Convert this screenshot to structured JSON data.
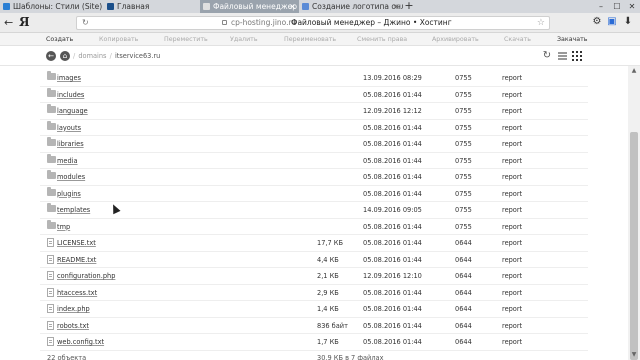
{
  "browser": {
    "tabs": [
      {
        "title": "Шаблоны: Стили (Site) - Ко",
        "favicon_color": "#2a7fd4",
        "active": false
      },
      {
        "title": "Главная",
        "favicon_color": "#1b4f8a",
        "active": false
      },
      {
        "title": "Файловый менеджер",
        "favicon_color": "#e0e0e0",
        "active": true
      },
      {
        "title": "Создание логотипа онлайн",
        "favicon_color": "#5b8bd6",
        "active": false
      }
    ],
    "new_tab": "+",
    "close_glyph": "×",
    "window_controls": [
      "–",
      "☐",
      "✕"
    ],
    "address": {
      "host": "cp-hosting.jino.ru",
      "page_title": "Файловый менеджер – Джино • Хостинг"
    },
    "logo": "Я"
  },
  "fm_toolbar": {
    "actions": [
      {
        "label": "Создать",
        "enabled": true
      },
      {
        "label": "Копировать",
        "enabled": false
      },
      {
        "label": "Переместить",
        "enabled": false
      },
      {
        "label": "Удалить",
        "enabled": false
      },
      {
        "label": "Переименовать",
        "enabled": false
      },
      {
        "label": "Сменить права",
        "enabled": false
      },
      {
        "label": "Архивировать",
        "enabled": false
      },
      {
        "label": "Скачать",
        "enabled": false
      },
      {
        "label": "Закачать",
        "enabled": true
      }
    ]
  },
  "path": {
    "separator": "/",
    "root": "domains",
    "current": "itservice63.ru"
  },
  "files": [
    {
      "name": "images",
      "type": "folder",
      "size": "",
      "date": "13.09.2016 08:29",
      "perm": "0755",
      "owner": "report"
    },
    {
      "name": "includes",
      "type": "folder",
      "size": "",
      "date": "05.08.2016 01:44",
      "perm": "0755",
      "owner": "report"
    },
    {
      "name": "language",
      "type": "folder",
      "size": "",
      "date": "12.09.2016 12:12",
      "perm": "0755",
      "owner": "report"
    },
    {
      "name": "layouts",
      "type": "folder",
      "size": "",
      "date": "05.08.2016 01:44",
      "perm": "0755",
      "owner": "report"
    },
    {
      "name": "libraries",
      "type": "folder",
      "size": "",
      "date": "05.08.2016 01:44",
      "perm": "0755",
      "owner": "report"
    },
    {
      "name": "media",
      "type": "folder",
      "size": "",
      "date": "05.08.2016 01:44",
      "perm": "0755",
      "owner": "report"
    },
    {
      "name": "modules",
      "type": "folder",
      "size": "",
      "date": "05.08.2016 01:44",
      "perm": "0755",
      "owner": "report"
    },
    {
      "name": "plugins",
      "type": "folder",
      "size": "",
      "date": "05.08.2016 01:44",
      "perm": "0755",
      "owner": "report"
    },
    {
      "name": "templates",
      "type": "folder",
      "size": "",
      "date": "14.09.2016 09:05",
      "perm": "0755",
      "owner": "report"
    },
    {
      "name": "tmp",
      "type": "folder",
      "size": "",
      "date": "05.08.2016 01:44",
      "perm": "0755",
      "owner": "report"
    },
    {
      "name": "LICENSE.txt",
      "type": "file",
      "size": "17,7 КБ",
      "date": "05.08.2016 01:44",
      "perm": "0644",
      "owner": "report"
    },
    {
      "name": "README.txt",
      "type": "file",
      "size": "4,4 КБ",
      "date": "05.08.2016 01:44",
      "perm": "0644",
      "owner": "report"
    },
    {
      "name": "configuration.php",
      "type": "file",
      "size": "2,1 КБ",
      "date": "12.09.2016 12:10",
      "perm": "0644",
      "owner": "report"
    },
    {
      "name": "htaccess.txt",
      "type": "file",
      "size": "2,9 КБ",
      "date": "05.08.2016 01:44",
      "perm": "0644",
      "owner": "report"
    },
    {
      "name": "index.php",
      "type": "file",
      "size": "1,4 КБ",
      "date": "05.08.2016 01:44",
      "perm": "0644",
      "owner": "report"
    },
    {
      "name": "robots.txt",
      "type": "file",
      "size": "836 байт",
      "date": "05.08.2016 01:44",
      "perm": "0644",
      "owner": "report"
    },
    {
      "name": "web.config.txt",
      "type": "file",
      "size": "1,7 КБ",
      "date": "05.08.2016 01:44",
      "perm": "0644",
      "owner": "report"
    }
  ],
  "footer": {
    "objects": "22 объекта",
    "total": "30,9 КБ в 7 файлах"
  }
}
